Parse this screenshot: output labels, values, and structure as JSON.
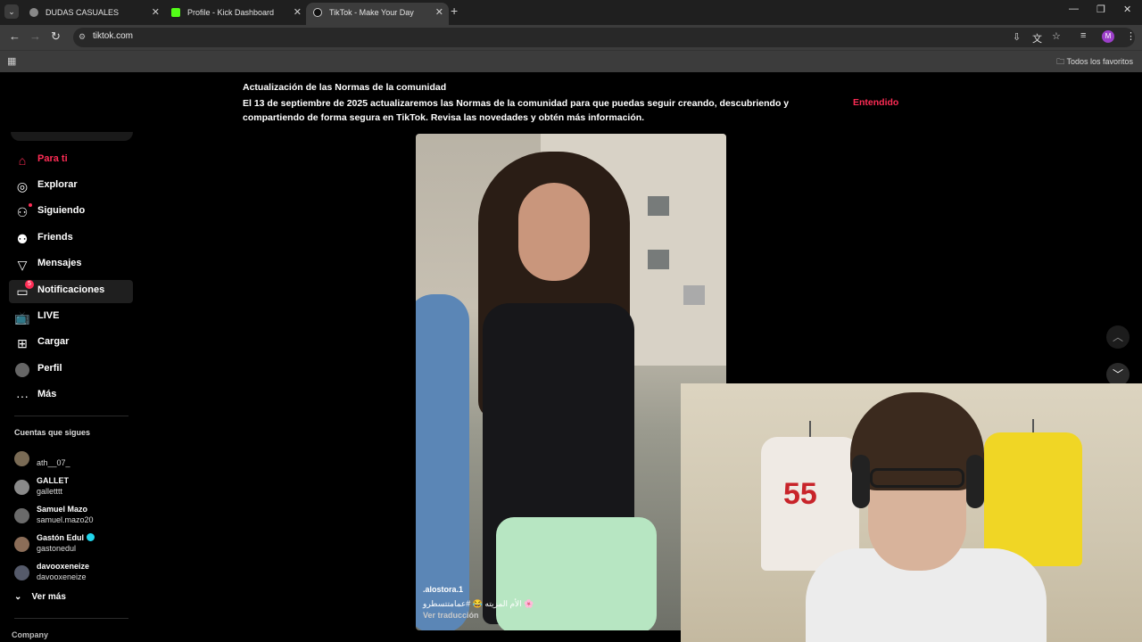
{
  "browser": {
    "tabs": [
      {
        "title": "DUDAS CASUALES",
        "favicon": "globe-icon",
        "active": false
      },
      {
        "title": "Profile - Kick Dashboard",
        "favicon": "kick-icon",
        "active": false
      },
      {
        "title": "TikTok - Make Your Day",
        "favicon": "tiktok-icon",
        "active": true
      }
    ],
    "url": "tiktok.com",
    "profile_initial": "M",
    "bookmarks_all_label": "Todos los favoritos"
  },
  "notice": {
    "title": "Actualización de las Normas de la comunidad",
    "body": "El 13 de septiembre de 2025 actualizaremos las Normas de la comunidad para que puedas seguir creando, descubriendo y compartiendo de forma segura en TikTok. Revisa las novedades y obtén más información.",
    "action": "Entendido"
  },
  "sidebar": {
    "nav": [
      {
        "label": "Para ti",
        "icon": "home-icon",
        "active": true
      },
      {
        "label": "Explorar",
        "icon": "compass-icon"
      },
      {
        "label": "Siguiendo",
        "icon": "following-icon"
      },
      {
        "label": "Friends",
        "icon": "friends-icon"
      },
      {
        "label": "Mensajes",
        "icon": "send-icon"
      },
      {
        "label": "Notificaciones",
        "icon": "inbox-icon",
        "badge": "5"
      },
      {
        "label": "LIVE",
        "icon": "live-tv-icon"
      },
      {
        "label": "Cargar",
        "icon": "upload-icon"
      },
      {
        "label": "Perfil",
        "icon": "avatar-icon"
      },
      {
        "label": "Más",
        "icon": "more-icon"
      }
    ],
    "following_title": "Cuentas que sigues",
    "accounts": [
      {
        "name": "",
        "handle": "ath__07_"
      },
      {
        "name": "GALLET",
        "handle": "galletttt"
      },
      {
        "name": "Samuel Mazo",
        "handle": "samuel.mazo20"
      },
      {
        "name": "Gastón Edul",
        "handle": "gastonedul",
        "verified": true
      },
      {
        "name": "davooxeneize",
        "handle": "davooxeneize"
      }
    ],
    "see_more": "Ver más",
    "company": "Company"
  },
  "video": {
    "username": ".alostora.1",
    "description": "الأم المزيته 😂 #عمامتتسطرو 🌸",
    "translate": "Ver traducción"
  }
}
